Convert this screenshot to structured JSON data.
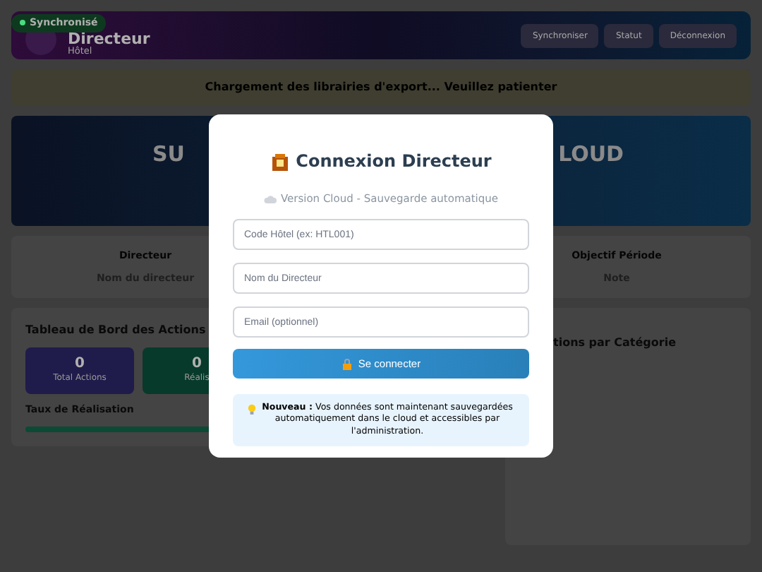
{
  "header": {
    "sync_badge": "Synchronisé",
    "title": "Directeur",
    "subtitle": "Hôtel",
    "buttons": [
      "Synchroniser",
      "Statut",
      "Déconnexion"
    ]
  },
  "banner": "Chargement des librairies d'export... Veuillez patienter",
  "hero": {
    "title_left": "SU",
    "title_right": "LOUD"
  },
  "info": [
    {
      "label": "Directeur",
      "value": "Nom du directeur"
    },
    {
      "label": "Objectif Période",
      "value": "Note"
    }
  ],
  "dashboard": {
    "title": "Tableau de Bord des Actions",
    "stats": [
      {
        "value": "0",
        "label": "Total Actions",
        "color": "#1f1b4a"
      },
      {
        "value": "0",
        "label": "Réalis",
        "color": "#073a2a"
      }
    ],
    "rate_title": "Taux de Réalisation"
  },
  "category_card": {
    "title": "tions par Catégorie"
  },
  "modal": {
    "title": "Connexion Directeur",
    "subtitle": "Version Cloud - Sauvegarde automatique",
    "fields": [
      {
        "placeholder": "Code Hôtel (ex: HTL001)"
      },
      {
        "placeholder": "Nom du Directeur"
      },
      {
        "placeholder": "Email (optionnel)"
      }
    ],
    "button": "Se connecter",
    "note": "**Nouveau :** Vos données sont maintenant sauvegardées automatiquement dans le cloud et accessibles par l'administration."
  }
}
